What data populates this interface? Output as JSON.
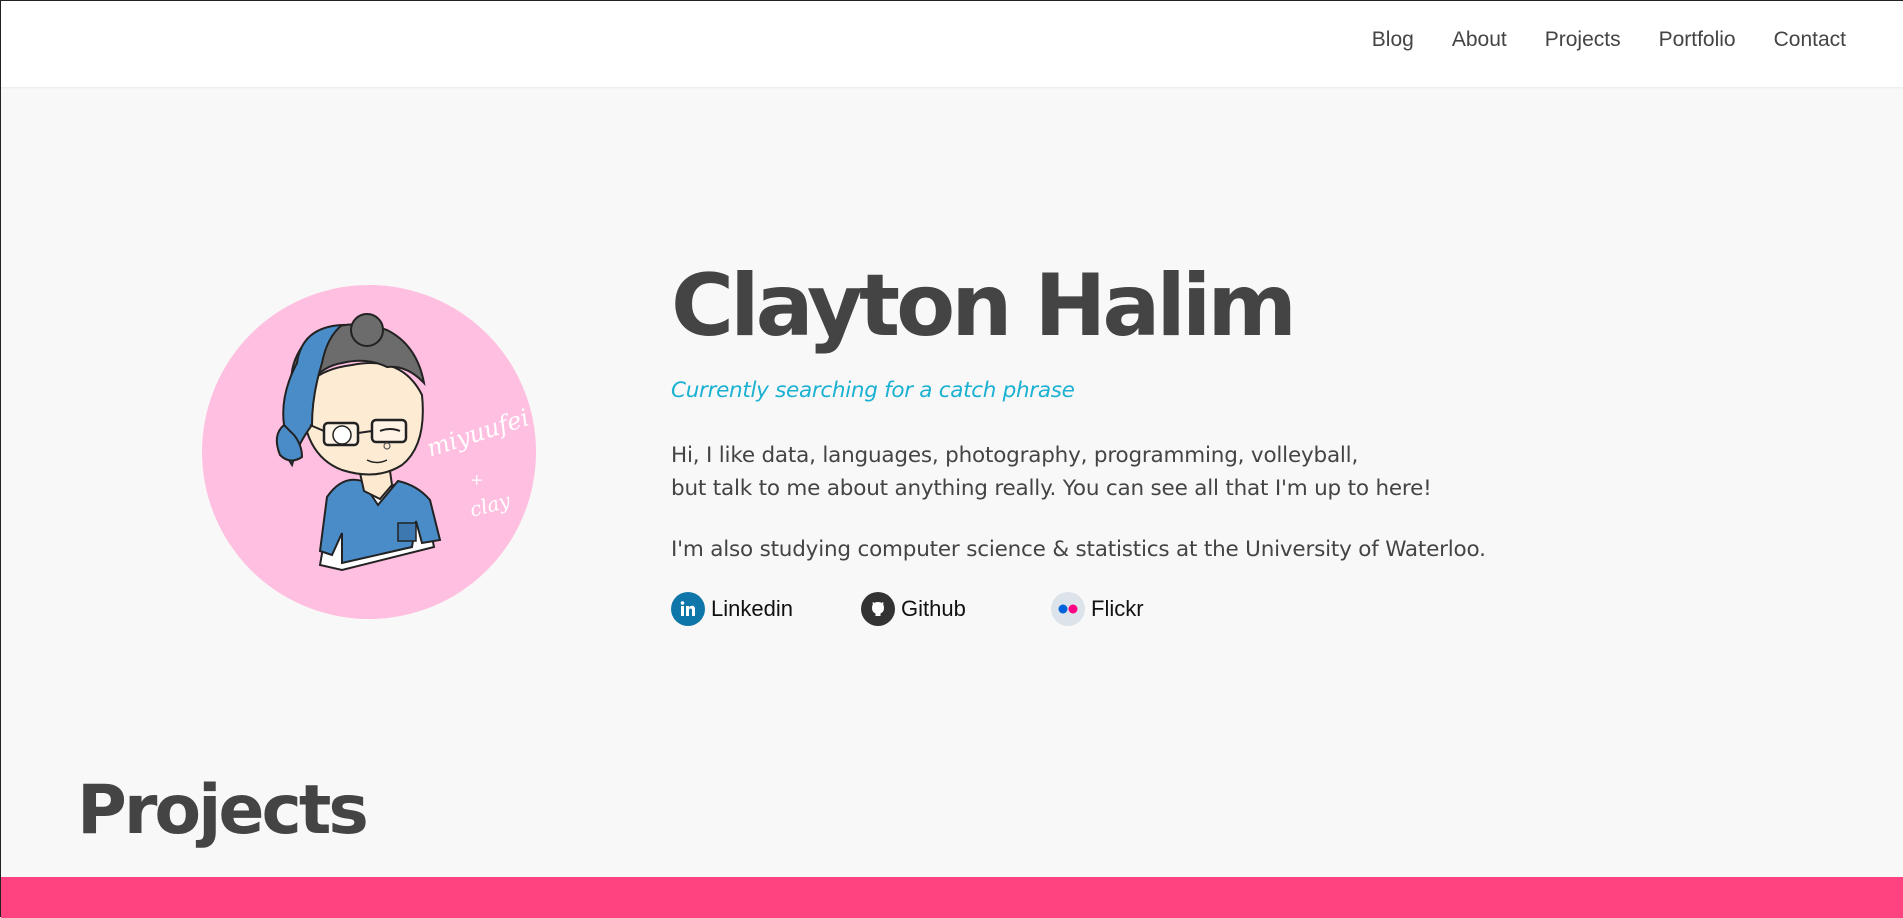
{
  "nav": {
    "items": [
      {
        "label": "Blog"
      },
      {
        "label": "About"
      },
      {
        "label": "Projects"
      },
      {
        "label": "Portfolio"
      },
      {
        "label": "Contact"
      }
    ]
  },
  "hero": {
    "name": "Clayton Halim",
    "tagline": "Currently searching for a catch phrase",
    "bio_line1": "Hi, I like data, languages, photography, programming, volleyball,",
    "bio_line2": "but talk to me about anything really. You can see all that I'm up to here!",
    "bio_line3": "I'm also studying computer science & statistics at the University of Waterloo.",
    "avatar_signature": "miyuufei + clay"
  },
  "socials": [
    {
      "label": "Linkedin",
      "icon": "linkedin-icon",
      "color": "#0e76a8"
    },
    {
      "label": "Github",
      "icon": "github-icon",
      "color": "#333333"
    },
    {
      "label": "Flickr",
      "icon": "flickr-icon",
      "color": "#dde3ea"
    }
  ],
  "sections": {
    "projects_heading": "Projects"
  },
  "colors": {
    "accent_pink": "#ff4380",
    "avatar_bg": "#ffbfe0",
    "tagline": "#1ab1d2",
    "text": "#444444",
    "page_bg": "#f8f8f8"
  }
}
